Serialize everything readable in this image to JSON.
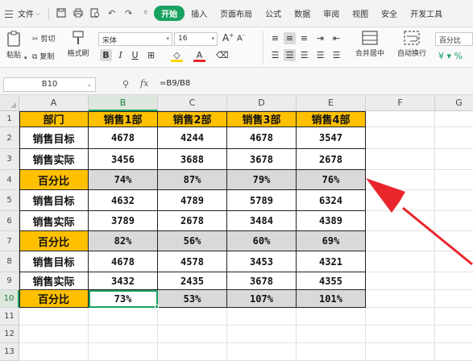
{
  "menubar": {
    "file_label": "文件",
    "tabs": [
      "开始",
      "插入",
      "页面布局",
      "公式",
      "数据",
      "审阅",
      "视图",
      "安全",
      "开发工具"
    ],
    "active_tab": "开始",
    "accent": "#1aa260"
  },
  "ribbon": {
    "paste": "粘贴",
    "cut": "剪切",
    "copy": "复制",
    "format_painter": "格式刷",
    "font_name": "宋体",
    "font_size": "16",
    "merge_center": "合并居中",
    "wrap_text": "自动换行",
    "number_format": "百分比"
  },
  "formula_bar": {
    "cell_ref": "B10",
    "formula": "=B9/B8"
  },
  "sheet": {
    "columns": [
      "A",
      "B",
      "C",
      "D",
      "E",
      "F",
      "G"
    ],
    "active_column": "B",
    "rows": [
      "1",
      "2",
      "3",
      "4",
      "5",
      "6",
      "7",
      "8",
      "9",
      "10",
      "11",
      "12",
      "13"
    ],
    "active_row": "10",
    "header_color": "#ffc000",
    "percent_row_color": "#d9d9d9",
    "data": [
      [
        "部门",
        "销售1部",
        "销售2部",
        "销售3部",
        "销售4部"
      ],
      [
        "销售目标",
        "4678",
        "4244",
        "4678",
        "3547"
      ],
      [
        "销售实际",
        "3456",
        "3688",
        "3678",
        "2678"
      ],
      [
        "百分比",
        "74%",
        "87%",
        "79%",
        "76%"
      ],
      [
        "销售目标",
        "4632",
        "4789",
        "5789",
        "6324"
      ],
      [
        "销售实际",
        "3789",
        "2678",
        "3484",
        "4389"
      ],
      [
        "百分比",
        "82%",
        "56%",
        "60%",
        "69%"
      ],
      [
        "销售目标",
        "4678",
        "4578",
        "3453",
        "4321"
      ],
      [
        "销售实际",
        "3432",
        "2435",
        "3678",
        "4355"
      ],
      [
        "百分比",
        "73%",
        "53%",
        "107%",
        "101%"
      ]
    ],
    "arrow_color": "#e8262c"
  }
}
